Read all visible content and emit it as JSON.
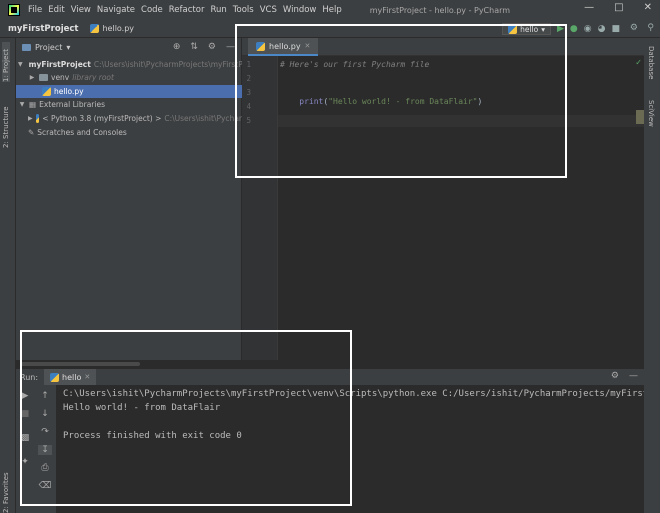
{
  "titlebar": {
    "menu": [
      "File",
      "Edit",
      "View",
      "Navigate",
      "Code",
      "Refactor",
      "Run",
      "Tools",
      "VCS",
      "Window",
      "Help"
    ],
    "window_title": "myFirstProject - hello.py - PyCharm"
  },
  "navbar": {
    "project": "myFirstProject",
    "file": "hello.py",
    "run_config": "hello"
  },
  "left_stripe": {
    "project_tab": "1: Project",
    "structure_tab": "2: Structure",
    "favorites_tab": "2: Favorites"
  },
  "right_stripe": {
    "database_tab": "Database",
    "sciview_tab": "SciView"
  },
  "project_panel": {
    "title": "Project",
    "tree": {
      "root_name": "myFirstProject",
      "root_path": "C:\\Users\\ishit\\PycharmProjects\\myFirstP",
      "venv_name": "venv",
      "venv_note": "library root",
      "file": "hello.py",
      "ext_libs": "External Libraries",
      "python_sdk": "< Python 3.8 (myFirstProject) >",
      "python_path": "C:\\Users\\ishit\\Pychar",
      "scratches": "Scratches and Consoles"
    }
  },
  "editor": {
    "tab_label": "hello.py",
    "line_numbers": [
      "1",
      "2",
      "3",
      "4",
      "5"
    ],
    "line1": "# Here's our first Pycharm file",
    "line3_fn": "print",
    "line3_open": "(",
    "line3_str": "\"Hello world! - from DataFlair\"",
    "line3_close": ")"
  },
  "run_panel": {
    "label": "Run:",
    "tab": "hello",
    "console": [
      "C:\\Users\\ishit\\PycharmProjects\\myFirstProject\\venv\\Scripts\\python.exe C:/Users/ishit/PycharmProjects/myFirst",
      "Hello world! - from DataFlair",
      "",
      "Process finished with exit code 0"
    ]
  }
}
